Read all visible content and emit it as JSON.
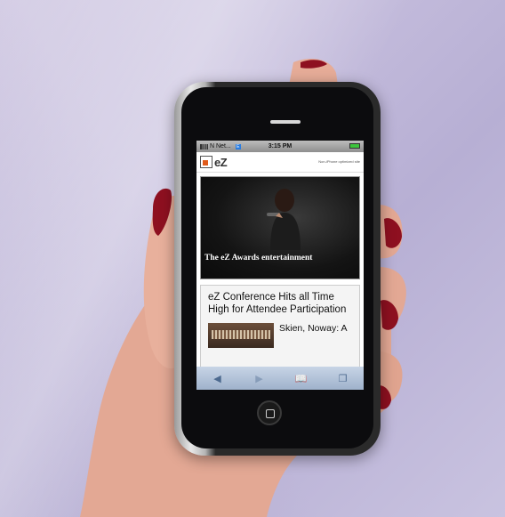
{
  "status_bar": {
    "carrier": "N Net...",
    "time": "3:15 PM"
  },
  "site": {
    "logo": "eZ",
    "optimized_note": "Non-iPhone optimized site"
  },
  "hero": {
    "caption": "The eZ Awards entertainment"
  },
  "article": {
    "title": "eZ Conference Hits all Time High for Attendee Participation",
    "snippet": "Skien, Noway: A"
  },
  "toolbar": {
    "back_icon": "back-arrow-icon",
    "forward_icon": "forward-arrow-icon",
    "bookmarks_icon": "bookmarks-icon",
    "pages_icon": "pages-icon"
  },
  "colors": {
    "background": "#c4bcdc",
    "nail_polish": "#8e1020",
    "logo_accent": "#e05a1a",
    "toolbar": "#a9bbd3"
  }
}
